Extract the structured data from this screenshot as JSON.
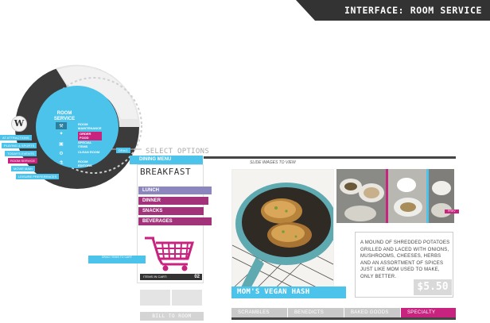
{
  "header": {
    "title": "INTERFACE: ROOM SERVICE"
  },
  "wheel": {
    "logo": "W",
    "title": "ROOM SERVICE",
    "menu_items": [
      "ROOM MAINTENANCE",
      "ORDER FOOD",
      "SPECIAL ITEMS",
      "CLEAN ROOM",
      "ROOM EDITORS"
    ],
    "left_tags": [
      "AT ATTRACTIONS",
      "PLAYING & SPORTS",
      "TODAY'S EVENTS",
      "ROOM SERVICE",
      "MOVIE MAIN",
      "LEISURE PREFERENCES"
    ],
    "pointer_tag": "DRAG"
  },
  "colors": {
    "accent_blue": "#4cc3ea",
    "accent_pink": "#c8237f",
    "accent_purple": "#a2337a",
    "lavender": "#8c86bf",
    "dark": "#333333"
  },
  "options": {
    "heading": "SELECT OPTIONS",
    "tab": "DINING MENU",
    "selected_category": "BREAKFAST",
    "categories": [
      "LUNCH",
      "DINNER",
      "SNACKS",
      "BEVERAGES"
    ],
    "drag_note": "DRAG ITEMS TO CART",
    "items_label": "ITEMS IN CART:",
    "items_count": "02",
    "bill_button": "BILL TO ROOM"
  },
  "product": {
    "slide_hint": "SLIDE IMAGES TO VIEW",
    "dish_name": "MOM'S VEGAN HASH",
    "description": "A MOUND OF SHREDDED POTATOES GRILLED AND LACED WITH ONIONS, MUSHROOMS, CHEESES, HERBS AND AN ASSORTMENT OF SPICES JUST LIKE MOM USED TO MAKE, ONLY BETTER.",
    "price": "$5.50",
    "prev_tag": "PREV"
  },
  "bottom_tabs": [
    {
      "label": "SCRAMBLES",
      "active": false
    },
    {
      "label": "BENEDICTS",
      "active": false
    },
    {
      "label": "BAKED GOODS",
      "active": false
    },
    {
      "label": "SPECIALTY",
      "active": true
    }
  ]
}
